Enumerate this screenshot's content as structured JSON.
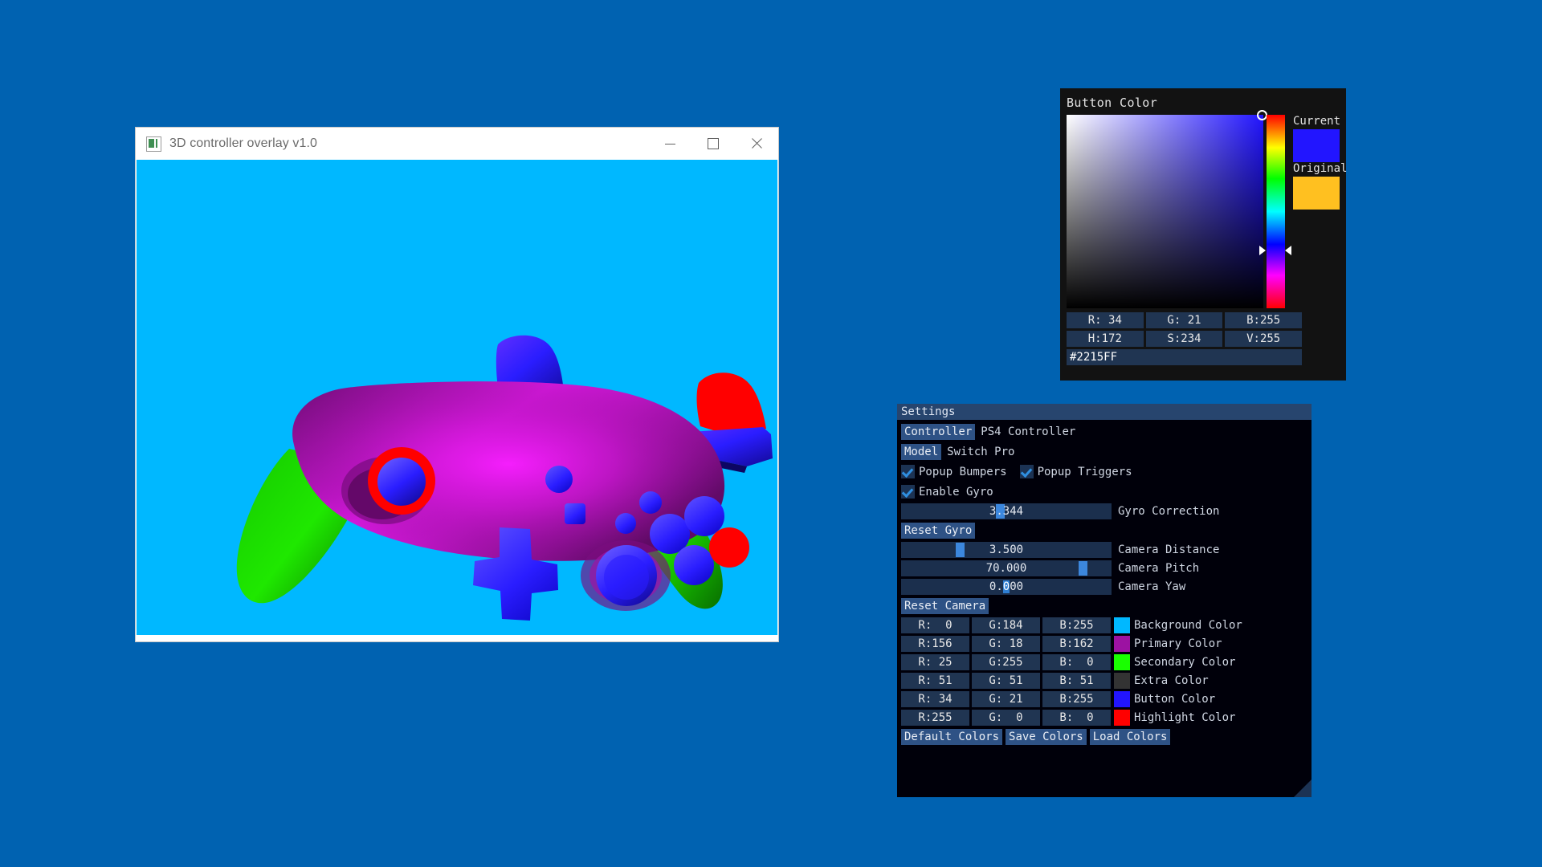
{
  "desktop": {
    "background_color": "#0062b1"
  },
  "overlay_window": {
    "title": "3D controller overlay v1.0",
    "icon": "app-icon",
    "controls": {
      "minimize": "minimize-icon",
      "maximize": "maximize-icon",
      "close": "close-icon"
    },
    "canvas": {
      "background_color": "#00b8ff",
      "render_subject": "3d-game-controller",
      "primary_color": "#9c12a2",
      "secondary_color": "#19ff00",
      "button_color": "#2215ff",
      "highlight_color": "#ff0000"
    }
  },
  "color_picker": {
    "title": "Button Color",
    "current_label": "Current",
    "original_label": "Original",
    "current_color": "#2215ff",
    "original_color": "#ffc020",
    "fields": {
      "r": "R: 34",
      "g": "G: 21",
      "b": "B:255",
      "h": "H:172",
      "s": "S:234",
      "v": "V:255"
    },
    "hex": "#2215FF"
  },
  "settings": {
    "title": "Settings",
    "controller": {
      "button_label": "Controller",
      "value": "PS4 Controller"
    },
    "model": {
      "button_label": "Model",
      "value": "Switch Pro"
    },
    "checkboxes": [
      {
        "label": "Popup Bumpers",
        "checked": true
      },
      {
        "label": "Popup Triggers",
        "checked": true
      },
      {
        "label": "Enable Gyro",
        "checked": true
      }
    ],
    "sliders": [
      {
        "label": "Gyro Correction",
        "value": "3.344",
        "handle_pct": 47
      },
      {
        "label": "Camera Distance",
        "value": "3.500",
        "handle_pct": 27
      },
      {
        "label": "Camera Pitch",
        "value": "70.000",
        "handle_pct": 88
      },
      {
        "label": "Camera Yaw",
        "value": "0.000",
        "handle_pct": -1,
        "editing": true,
        "selected_text": "0"
      }
    ],
    "reset_gyro_label": "Reset Gyro",
    "reset_camera_label": "Reset Camera",
    "colors": [
      {
        "r": "R:  0",
        "g": "G:184",
        "b": "B:255",
        "swatch": "#00b8ff",
        "label": "Background Color"
      },
      {
        "r": "R:156",
        "g": "G: 18",
        "b": "B:162",
        "swatch": "#9c12a2",
        "label": "Primary Color"
      },
      {
        "r": "R: 25",
        "g": "G:255",
        "b": "B:  0",
        "swatch": "#19ff00",
        "label": "Secondary Color"
      },
      {
        "r": "R: 51",
        "g": "G: 51",
        "b": "B: 51",
        "swatch": "#333333",
        "label": "Extra Color"
      },
      {
        "r": "R: 34",
        "g": "G: 21",
        "b": "B:255",
        "swatch": "#2215ff",
        "label": "Button Color"
      },
      {
        "r": "R:255",
        "g": "G:  0",
        "b": "B:  0",
        "swatch": "#ff0000",
        "label": "Highlight Color"
      }
    ],
    "buttons": {
      "default_colors": "Default Colors",
      "save_colors": "Save Colors",
      "load_colors": "Load Colors"
    }
  }
}
